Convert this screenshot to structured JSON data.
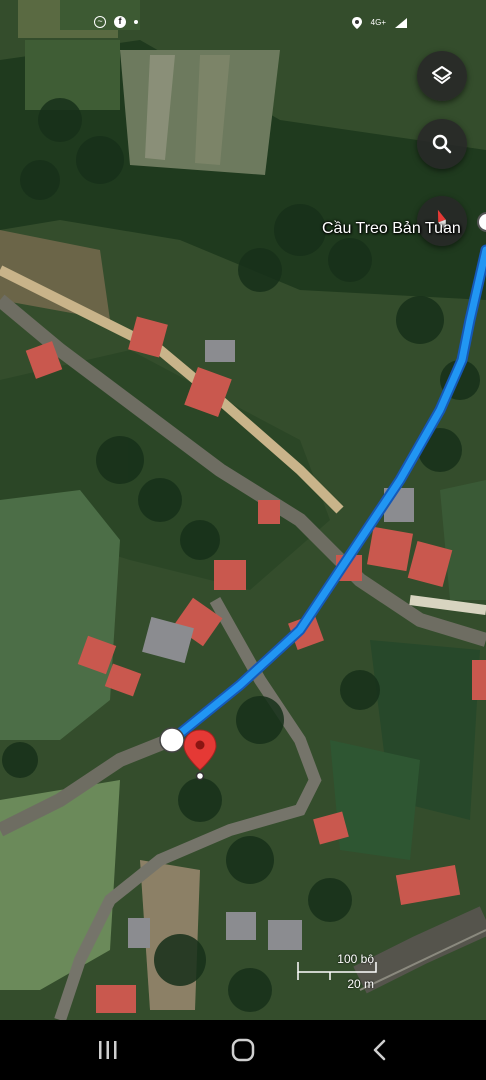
{
  "status_bar": {
    "time": "",
    "network": "4G+",
    "icons": [
      "messenger-icon",
      "facebook-icon",
      "notification-dot",
      "location-icon",
      "signal-icon"
    ]
  },
  "map": {
    "place_label": "Cầu Treo Bản Tuan",
    "scale": {
      "imperial": "100 bộ",
      "metric": "20 m"
    },
    "route_color": "#1a73e8",
    "pin_color": "#e53935",
    "controls": [
      "layers-icon",
      "search-icon",
      "compass-icon"
    ]
  },
  "nav_bar": {
    "buttons": [
      "recent-apps-icon",
      "home-icon",
      "back-icon"
    ]
  }
}
